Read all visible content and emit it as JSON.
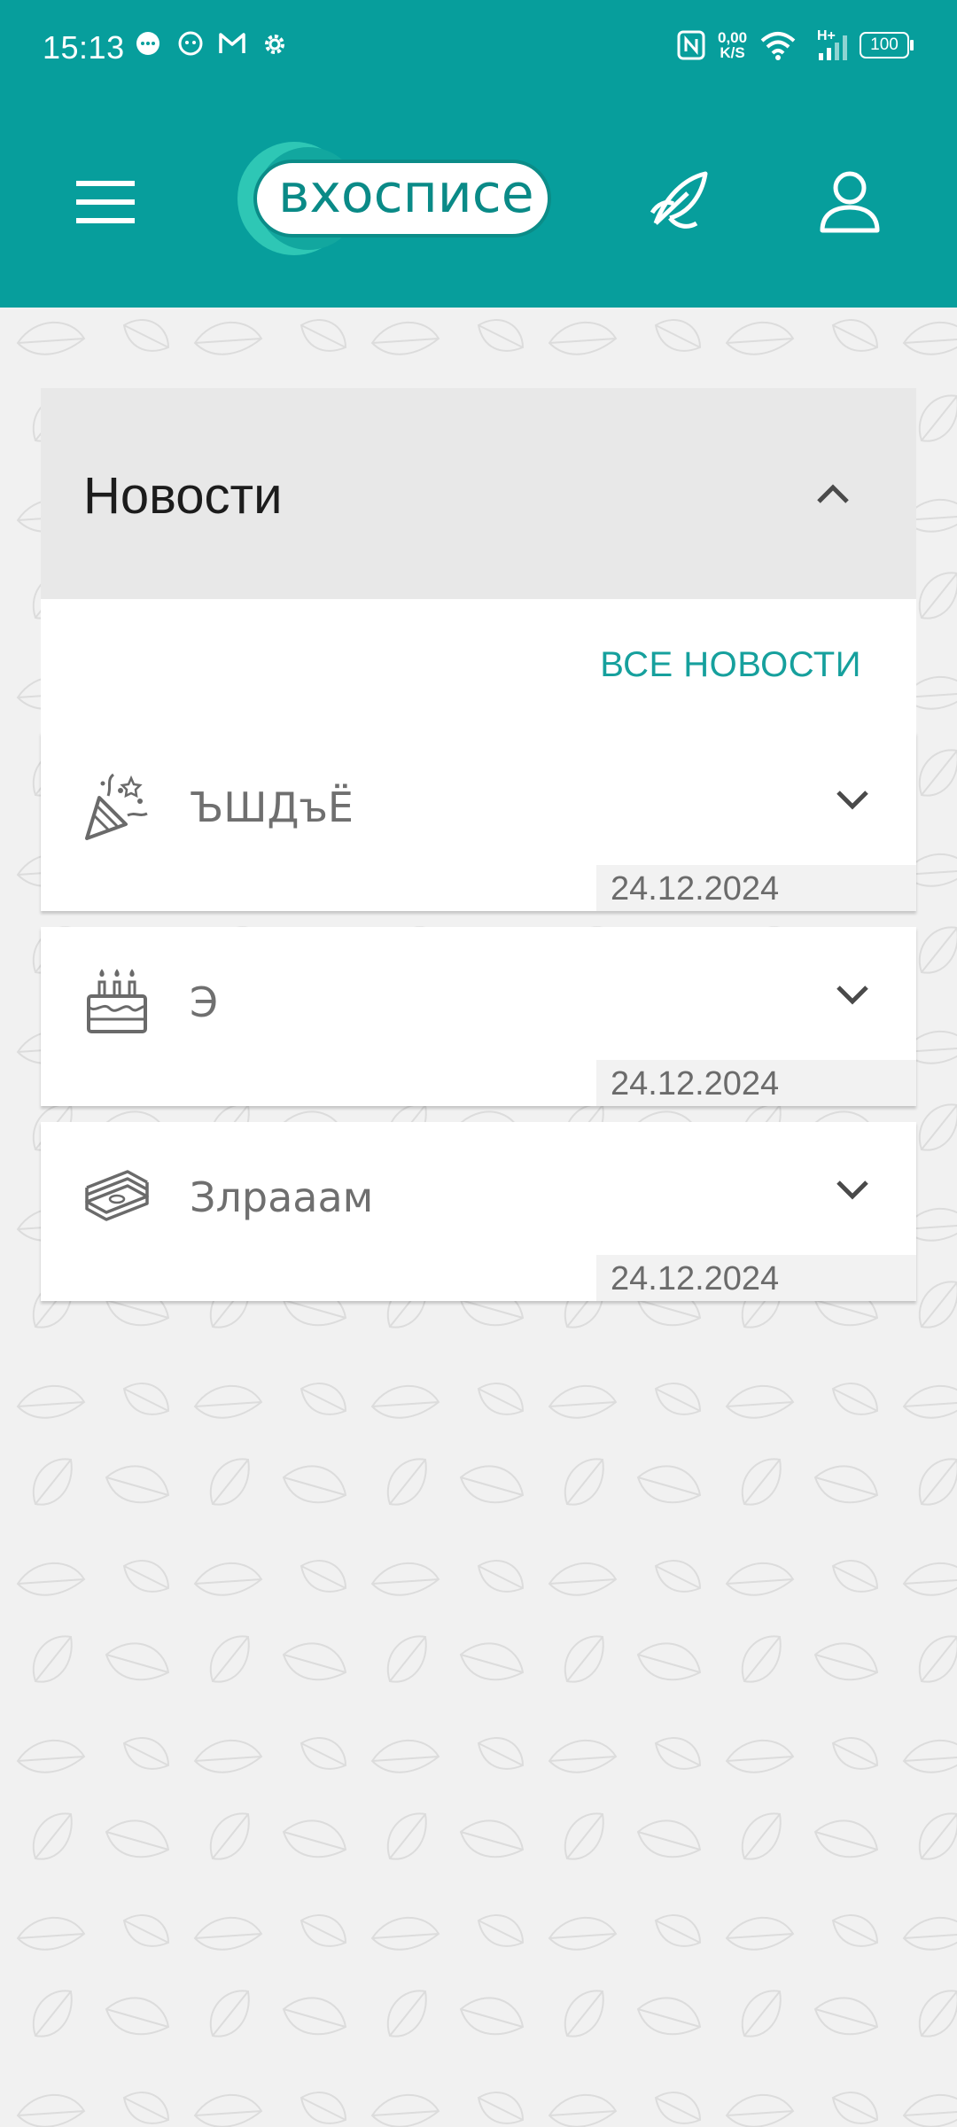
{
  "status_bar": {
    "time": "15:13",
    "net_speed_value": "0,00",
    "net_speed_unit": "K/S",
    "network": "H+",
    "battery": "100"
  },
  "header": {
    "logo_text": "вхосписе"
  },
  "news": {
    "title": "Новости",
    "all_news_label": "ВСЕ НОВОСТИ",
    "items": [
      {
        "title": "ЪШДъЁ",
        "date": "24.12.2024",
        "icon": "party-popper-icon"
      },
      {
        "title": "Э",
        "date": "24.12.2024",
        "icon": "birthday-cake-icon"
      },
      {
        "title": "Злрааам",
        "date": "24.12.2024",
        "icon": "money-stack-icon"
      }
    ]
  },
  "colors": {
    "brand": "#079e9c",
    "accent_text": "#16a09d",
    "background": "#f1f1f1"
  }
}
